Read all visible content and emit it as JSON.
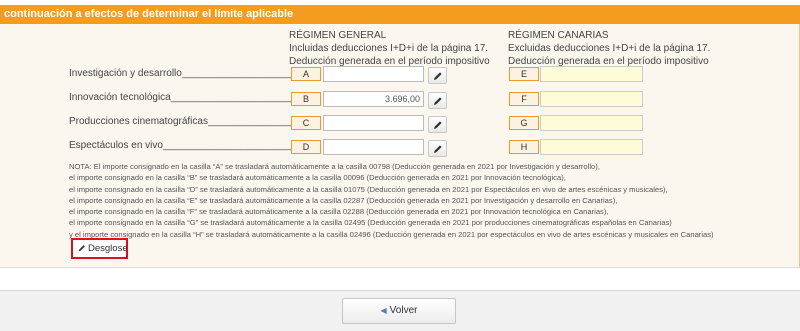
{
  "header": {
    "title": "continuación a efectos de determinar el límite aplicable"
  },
  "general": {
    "title": "RÉGIMEN GENERAL",
    "subtitle": "Incluidas deducciones I+D+i de la página 17.",
    "subtitle2": "Deducción generada en el período impositivo"
  },
  "canarias": {
    "title": "RÉGIMEN CANARIAS",
    "subtitle": "Excluidas deducciones I+D+i de la página 17.",
    "subtitle2": "Deducción generada en el período impositivo"
  },
  "rows": [
    {
      "label": "Investigación y desarrollo____________________",
      "general_letter": "A",
      "general_value": "",
      "canarias_letter": "E",
      "canarias_value": ""
    },
    {
      "label": "Innovación tecnológica_______________________",
      "general_letter": "B",
      "general_value": "3.696,00",
      "canarias_letter": "F",
      "canarias_value": ""
    },
    {
      "label": "Producciones cinematográficas_________________",
      "general_letter": "C",
      "general_value": "",
      "canarias_letter": "G",
      "canarias_value": ""
    },
    {
      "label": "Espectáculos en vivo_________________________",
      "general_letter": "D",
      "general_value": "",
      "canarias_letter": "H",
      "canarias_value": ""
    }
  ],
  "notes": [
    "NOTA: El importe consignado en la casilla “A” se trasladará automáticamente a la casilla 00798 (Deducción generada en 2021 por Investigación y desarrollo),",
    "el importe consignado en la casilla “B” se trasladará automáticamente a la casilla 00096 (Deducción generada en 2021 por Innovación tecnológica),",
    "el importe consignado en la casilla “D” se trasladará automáticamente a la casilla 01075 (Deducción generada en 2021 por Espectáculos en vivo de artes escénicas y musicales),",
    "el importe consignado en la casilla “E” se trasladará automáticamente a la casilla 02287 (Deducción generada en 2021 por Investigación y desarrollo en Canarias),",
    "el importe consignado en la casilla “F” se trasladará automáticamente a la casilla 02288 (Deducción generada en 2021 por Innovación tecnológica en Canarias),",
    "el importe consignado en la casilla “G” se trasladará automáticamente a la casilla 02495 (Deducción generada en 2021 por producciones cinematográficas españolas en Canarias)",
    "y el importe consignado en la casilla “H” se trasladará automáticamente a la casilla 02496 (Deducción generada en 2021 por espectáculos en vivo de artes escénicas y musicales en Canarias)"
  ],
  "buttons": {
    "desglose": "Desglose",
    "volver": "Volver"
  },
  "icons": {
    "edit": "pencil-icon",
    "back": "triangle-left-icon"
  },
  "colors": {
    "header": "#f39c1f",
    "panel": "#fcf7ee",
    "letter_border": "#e59a35",
    "canarias_field": "#fefbd8",
    "highlight": "#d5141c"
  }
}
